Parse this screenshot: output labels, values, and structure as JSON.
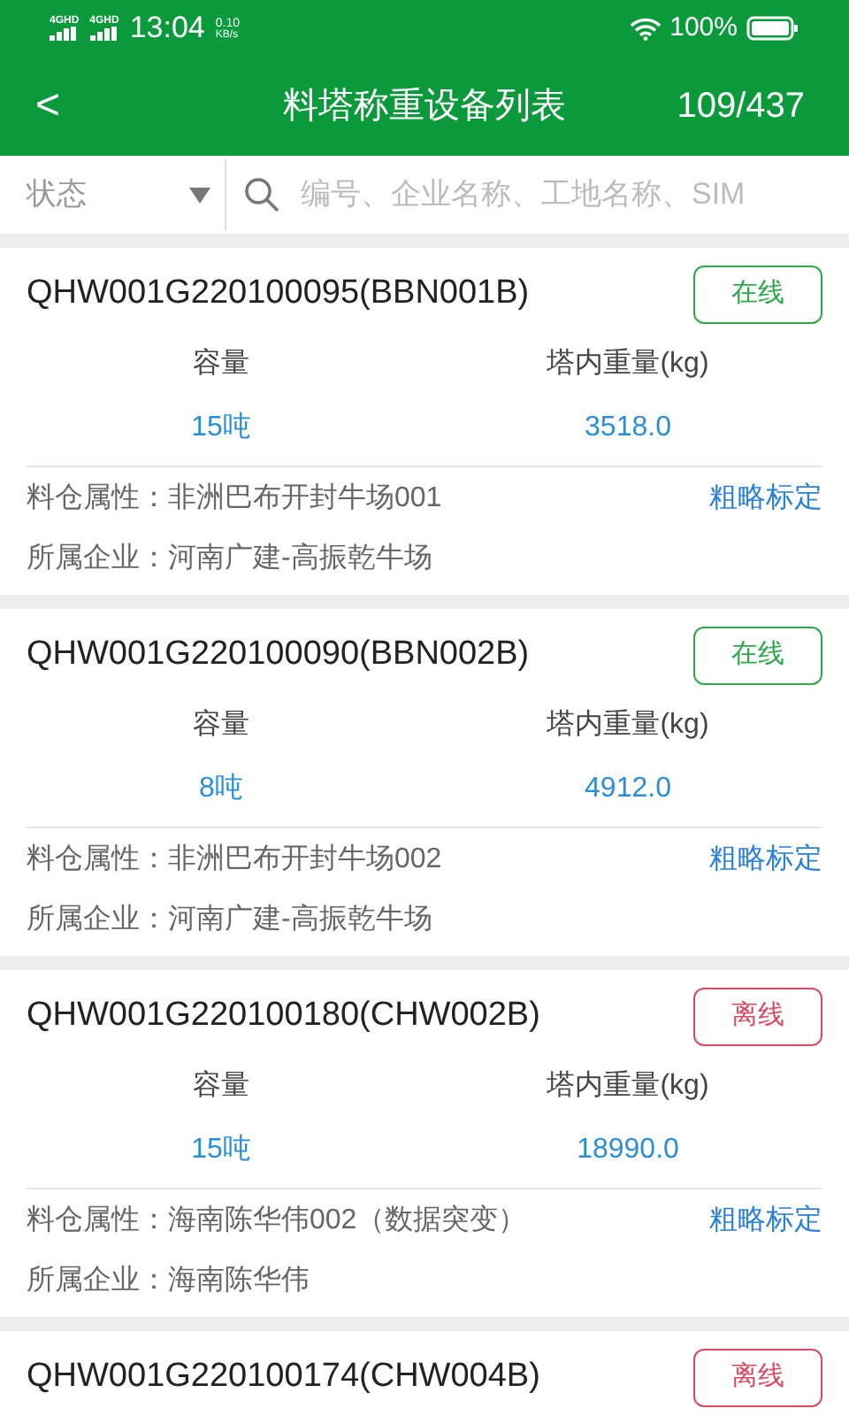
{
  "status_bar": {
    "networks": [
      "4GHD",
      "4GHD"
    ],
    "time": "13:04",
    "speed": "0.10",
    "speed_unit": "KB/s",
    "battery": "100%"
  },
  "header": {
    "back": "<",
    "title": "料塔称重设备列表",
    "count": "109/437"
  },
  "filter": {
    "status": "状态",
    "search_placeholder": "编号、企业名称、工地名称、SIM"
  },
  "devices": [
    {
      "title": "QHW001G220100095(BBN001B)",
      "online": true,
      "status": "在线",
      "capacity_label": "容量",
      "capacity": "15吨",
      "weight_label": "塔内重量(kg)",
      "weight": "3518.0",
      "attr_label": "料仓属性：",
      "attr": "非洲巴布开封牛场001",
      "action": "粗略标定",
      "company_label": "所属企业：",
      "company": "河南广建-高振乾牛场"
    },
    {
      "title": "QHW001G220100090(BBN002B)",
      "online": true,
      "status": "在线",
      "capacity_label": "容量",
      "capacity": "8吨",
      "weight_label": "塔内重量(kg)",
      "weight": "4912.0",
      "attr_label": "料仓属性：",
      "attr": "非洲巴布开封牛场002",
      "action": "粗略标定",
      "company_label": "所属企业：",
      "company": "河南广建-高振乾牛场"
    },
    {
      "title": "QHW001G220100180(CHW002B)",
      "online": false,
      "status": "离线",
      "capacity_label": "容量",
      "capacity": "15吨",
      "weight_label": "塔内重量(kg)",
      "weight": "18990.0",
      "attr_label": "料仓属性：",
      "attr": "海南陈华伟002（数据突变）",
      "action": "粗略标定",
      "company_label": "所属企业：",
      "company": "海南陈华伟"
    },
    {
      "title": "QHW001G220100174(CHW004B)",
      "online": false,
      "status": "离线"
    }
  ]
}
